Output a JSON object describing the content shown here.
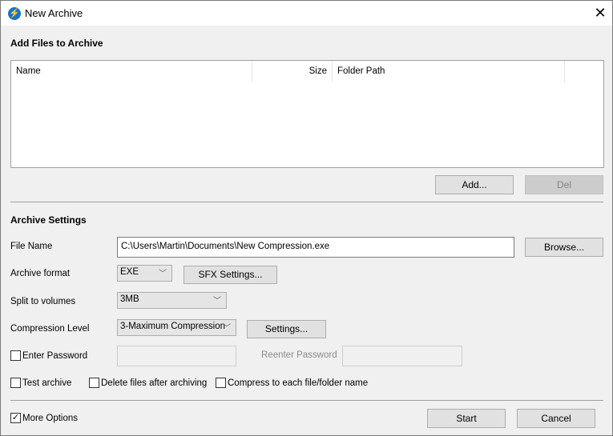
{
  "window": {
    "title": "New Archive",
    "accent": "#1a73c8"
  },
  "files": {
    "heading": "Add Files to Archive",
    "columns": [
      "Name",
      "Size",
      "Folder Path"
    ],
    "rows": [],
    "add": "Add...",
    "del": "Del"
  },
  "settings": {
    "heading": "Archive Settings",
    "file_name_label": "File Name",
    "file_name_value": "C:\\Users\\Martin\\Documents\\New Compression.exe",
    "browse": "Browse...",
    "format_label": "Archive format",
    "format_value": "EXE",
    "sfx": "SFX Settings...",
    "split_label": "Split to volumes",
    "split_value": "3MB",
    "level_label": "Compression Level",
    "level_value": "3-Maximum Compression",
    "level_settings": "Settings...",
    "password_label": "Enter Password",
    "password_checked": false,
    "reenter_label": "Reenter Password",
    "test_label": "Test archive",
    "test_checked": false,
    "delete_label": "Delete files after archiving",
    "delete_checked": false,
    "each_label": "Compress to each file/folder name",
    "each_checked": false
  },
  "footer": {
    "more_label": "More Options",
    "more_checked": true,
    "start": "Start",
    "cancel": "Cancel"
  }
}
